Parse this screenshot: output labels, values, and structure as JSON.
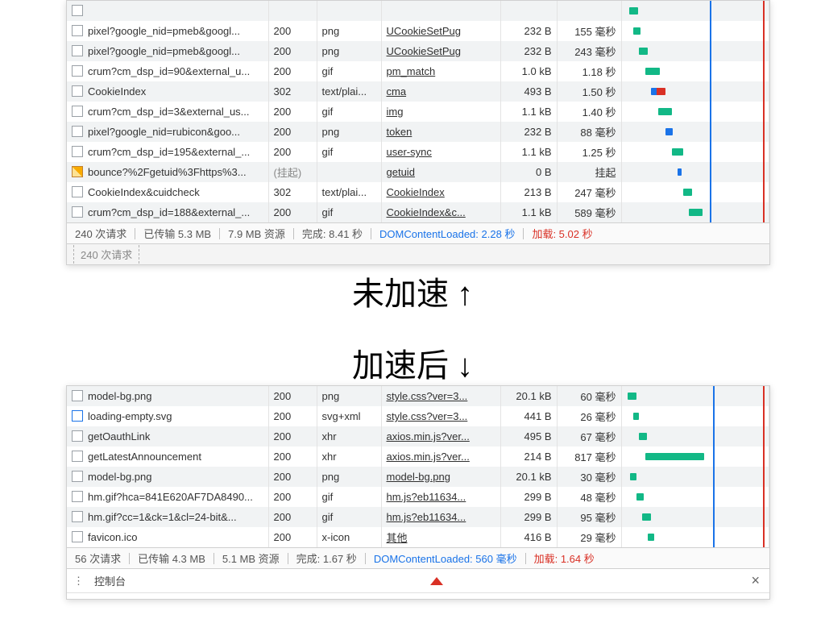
{
  "annotations": {
    "before": "未加速",
    "after": "加速后"
  },
  "top": {
    "rows": [
      {
        "name": "",
        "status": "",
        "type": "",
        "initiator": "",
        "size": "",
        "time": "",
        "wf": {
          "l": 5,
          "w": 6,
          "c": "green"
        }
      },
      {
        "name": "pixel?google_nid=pmeb&googl...",
        "status": "200",
        "type": "png",
        "initiator": "UCookieSetPug",
        "size": "232 B",
        "time": "155 毫秒",
        "wf": {
          "l": 8,
          "w": 5,
          "c": "green"
        }
      },
      {
        "name": "pixel?google_nid=pmeb&googl...",
        "status": "200",
        "type": "png",
        "initiator": "UCookieSetPug",
        "size": "232 B",
        "time": "243 毫秒",
        "wf": {
          "l": 12,
          "w": 6,
          "c": "green"
        }
      },
      {
        "name": "crum?cm_dsp_id=90&external_u...",
        "status": "200",
        "type": "gif",
        "initiator": "pm_match",
        "size": "1.0 kB",
        "time": "1.18 秒",
        "wf": {
          "l": 16,
          "w": 10,
          "c": "green"
        }
      },
      {
        "name": "CookieIndex",
        "status": "302",
        "type": "text/plai...",
        "initiator": "cma",
        "size": "493 B",
        "time": "1.50 秒",
        "wf": {
          "l": 20,
          "w": 10,
          "c": "mix"
        }
      },
      {
        "name": "crum?cm_dsp_id=3&external_us...",
        "status": "200",
        "type": "gif",
        "initiator": "img",
        "size": "1.1 kB",
        "time": "1.40 秒",
        "wf": {
          "l": 25,
          "w": 9,
          "c": "green"
        }
      },
      {
        "name": "pixel?google_nid=rubicon&goo...",
        "status": "200",
        "type": "png",
        "initiator": "token",
        "size": "232 B",
        "time": "88 毫秒",
        "wf": {
          "l": 30,
          "w": 5,
          "c": "blue"
        }
      },
      {
        "name": "crum?cm_dsp_id=195&external_...",
        "status": "200",
        "type": "gif",
        "initiator": "user-sync",
        "size": "1.1 kB",
        "time": "1.25 秒",
        "wf": {
          "l": 34,
          "w": 8,
          "c": "green"
        }
      },
      {
        "name": "bounce?%2Fgetuid%3Fhttps%3...",
        "status": "(挂起)",
        "type": "",
        "initiator": "getuid",
        "size": "0 B",
        "time": "挂起",
        "wf": {
          "l": 38,
          "w": 3,
          "c": "blue"
        },
        "icon": "img",
        "pending": true
      },
      {
        "name": "CookieIndex&cuidcheck",
        "status": "302",
        "type": "text/plai...",
        "initiator": "CookieIndex",
        "size": "213 B",
        "time": "247 毫秒",
        "wf": {
          "l": 42,
          "w": 6,
          "c": "green"
        }
      },
      {
        "name": "crum?cm_dsp_id=188&external_...",
        "status": "200",
        "type": "gif",
        "initiator": "CookieIndex&c...",
        "size": "1.1 kB",
        "time": "589 毫秒",
        "wf": {
          "l": 46,
          "w": 9,
          "c": "green"
        }
      }
    ],
    "waterfall_lines": {
      "blue": 60,
      "red": 96
    },
    "status": {
      "requests": "240 次请求",
      "transferred": "已传输 5.3 MB",
      "resources": "7.9 MB 资源",
      "finish": "完成: 8.41 秒",
      "dom": "DOMContentLoaded: 2.28 秒",
      "load": "加载: 5.02 秒"
    },
    "filter_hint": "240 次请求"
  },
  "bottom": {
    "rows": [
      {
        "name": "model-bg.png",
        "status": "200",
        "type": "png",
        "initiator": "style.css?ver=3...",
        "size": "20.1 kB",
        "time": "60 毫秒",
        "wf": {
          "l": 4,
          "w": 6,
          "c": "green"
        }
      },
      {
        "name": "loading-empty.svg",
        "status": "200",
        "type": "svg+xml",
        "initiator": "style.css?ver=3...",
        "size": "441 B",
        "time": "26 毫秒",
        "wf": {
          "l": 8,
          "w": 4,
          "c": "green"
        },
        "icon": "svg"
      },
      {
        "name": "getOauthLink",
        "status": "200",
        "type": "xhr",
        "initiator": "axios.min.js?ver...",
        "size": "495 B",
        "time": "67 毫秒",
        "wf": {
          "l": 12,
          "w": 5,
          "c": "green"
        }
      },
      {
        "name": "getLatestAnnouncement",
        "status": "200",
        "type": "xhr",
        "initiator": "axios.min.js?ver...",
        "size": "214 B",
        "time": "817 毫秒",
        "wf": {
          "l": 16,
          "w": 40,
          "c": "green"
        }
      },
      {
        "name": "model-bg.png",
        "status": "200",
        "type": "png",
        "initiator": "model-bg.png",
        "size": "20.1 kB",
        "time": "30 毫秒",
        "wf": {
          "l": 6,
          "w": 4,
          "c": "green"
        }
      },
      {
        "name": "hm.gif?hca=841E620AF7DA8490...",
        "status": "200",
        "type": "gif",
        "initiator": "hm.js?eb11634...",
        "size": "299 B",
        "time": "48 毫秒",
        "wf": {
          "l": 10,
          "w": 5,
          "c": "green"
        }
      },
      {
        "name": "hm.gif?cc=1&ck=1&cl=24-bit&...",
        "status": "200",
        "type": "gif",
        "initiator": "hm.js?eb11634...",
        "size": "299 B",
        "time": "95 毫秒",
        "wf": {
          "l": 14,
          "w": 6,
          "c": "green"
        }
      },
      {
        "name": "favicon.ico",
        "status": "200",
        "type": "x-icon",
        "initiator": "其他",
        "size": "416 B",
        "time": "29 毫秒",
        "wf": {
          "l": 18,
          "w": 4,
          "c": "green"
        }
      }
    ],
    "waterfall_lines": {
      "blue": 62,
      "red": 96
    },
    "status": {
      "requests": "56 次请求",
      "transferred": "已传输 4.3 MB",
      "resources": "5.1 MB 资源",
      "finish": "完成: 1.67 秒",
      "dom": "DOMContentLoaded: 560 毫秒",
      "load": "加载: 1.64 秒"
    },
    "drawer_tab": "控制台"
  }
}
